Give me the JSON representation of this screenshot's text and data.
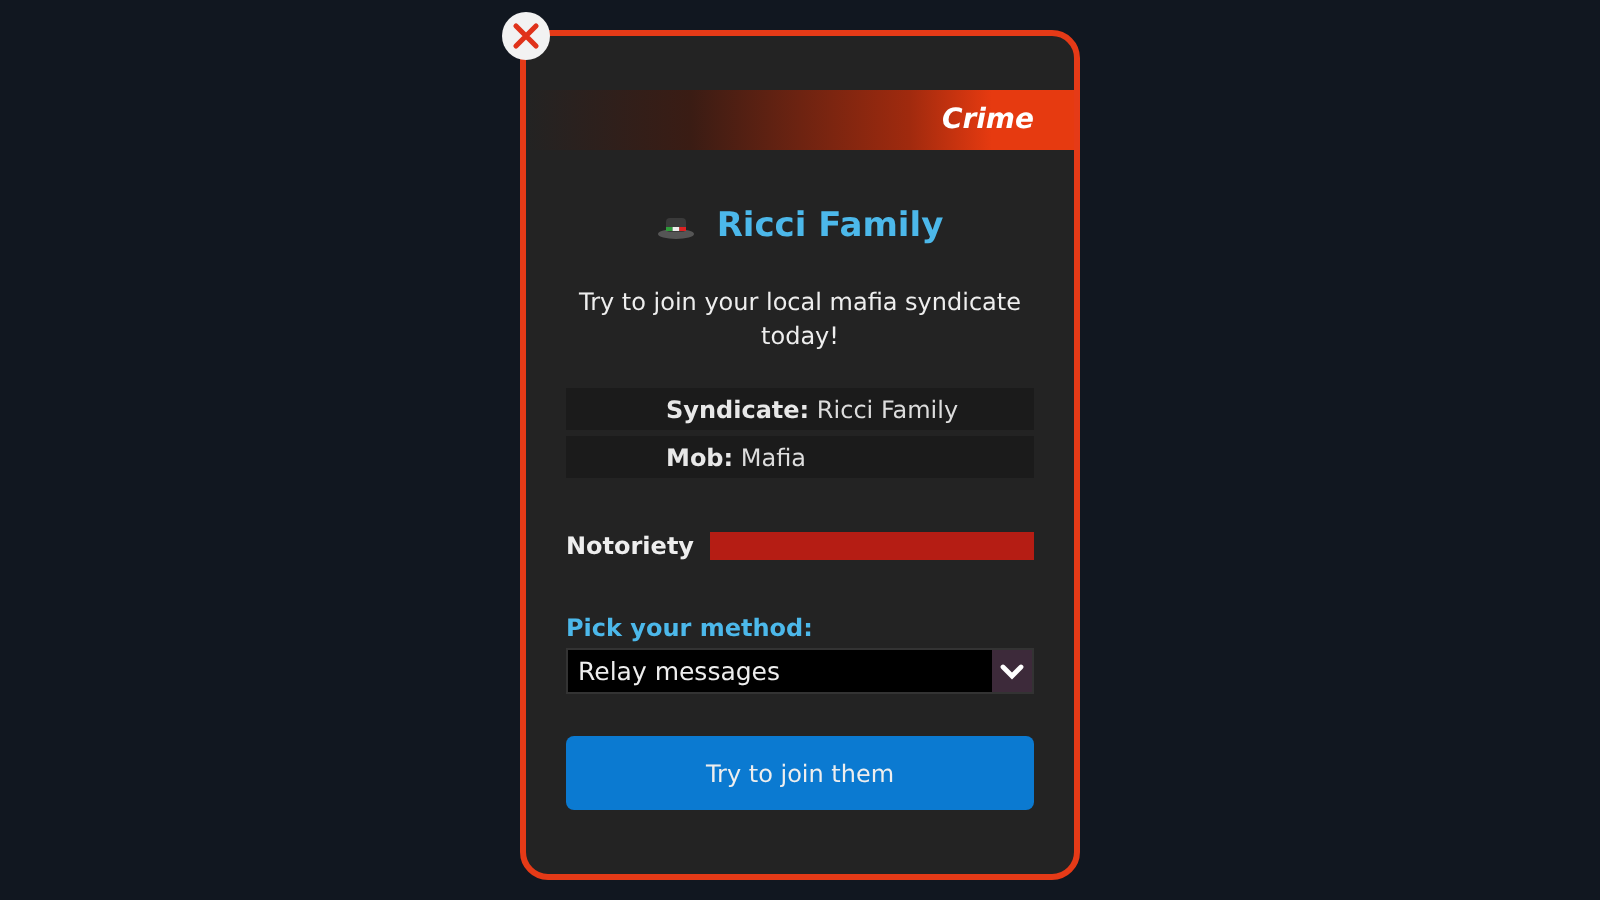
{
  "dialog": {
    "category": "Crime",
    "title": "Ricci Family",
    "description": "Try to join your local mafia syndicate today!",
    "details": [
      {
        "label": "Syndicate:",
        "value": "Ricci Family"
      },
      {
        "label": "Mob:",
        "value": "Mafia"
      }
    ],
    "meter": {
      "label": "Notoriety",
      "level": 1
    },
    "method": {
      "label": "Pick your method:",
      "value": "Relay messages"
    },
    "button": "Try to join them"
  }
}
